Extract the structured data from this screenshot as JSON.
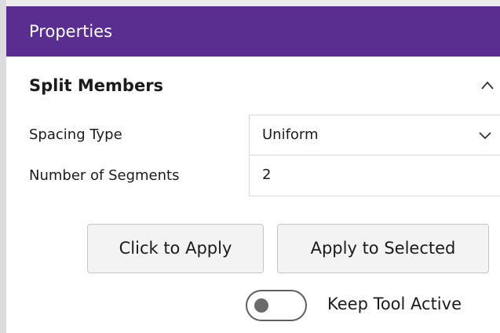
{
  "header": {
    "title": "Properties"
  },
  "section": {
    "title": "Split Members",
    "collapse_icon": "chevron-up-icon"
  },
  "fields": {
    "spacing_type": {
      "label": "Spacing Type",
      "value": "Uniform",
      "icon": "chevron-down-icon"
    },
    "segments": {
      "label": "Number of Segments",
      "value": "2"
    }
  },
  "buttons": {
    "click_to_apply": "Click to Apply",
    "apply_to_selected": "Apply to Selected"
  },
  "toggle": {
    "label": "Keep Tool Active",
    "on": false
  },
  "colors": {
    "header_bg": "#5a2e91",
    "header_text": "#ffffff"
  }
}
